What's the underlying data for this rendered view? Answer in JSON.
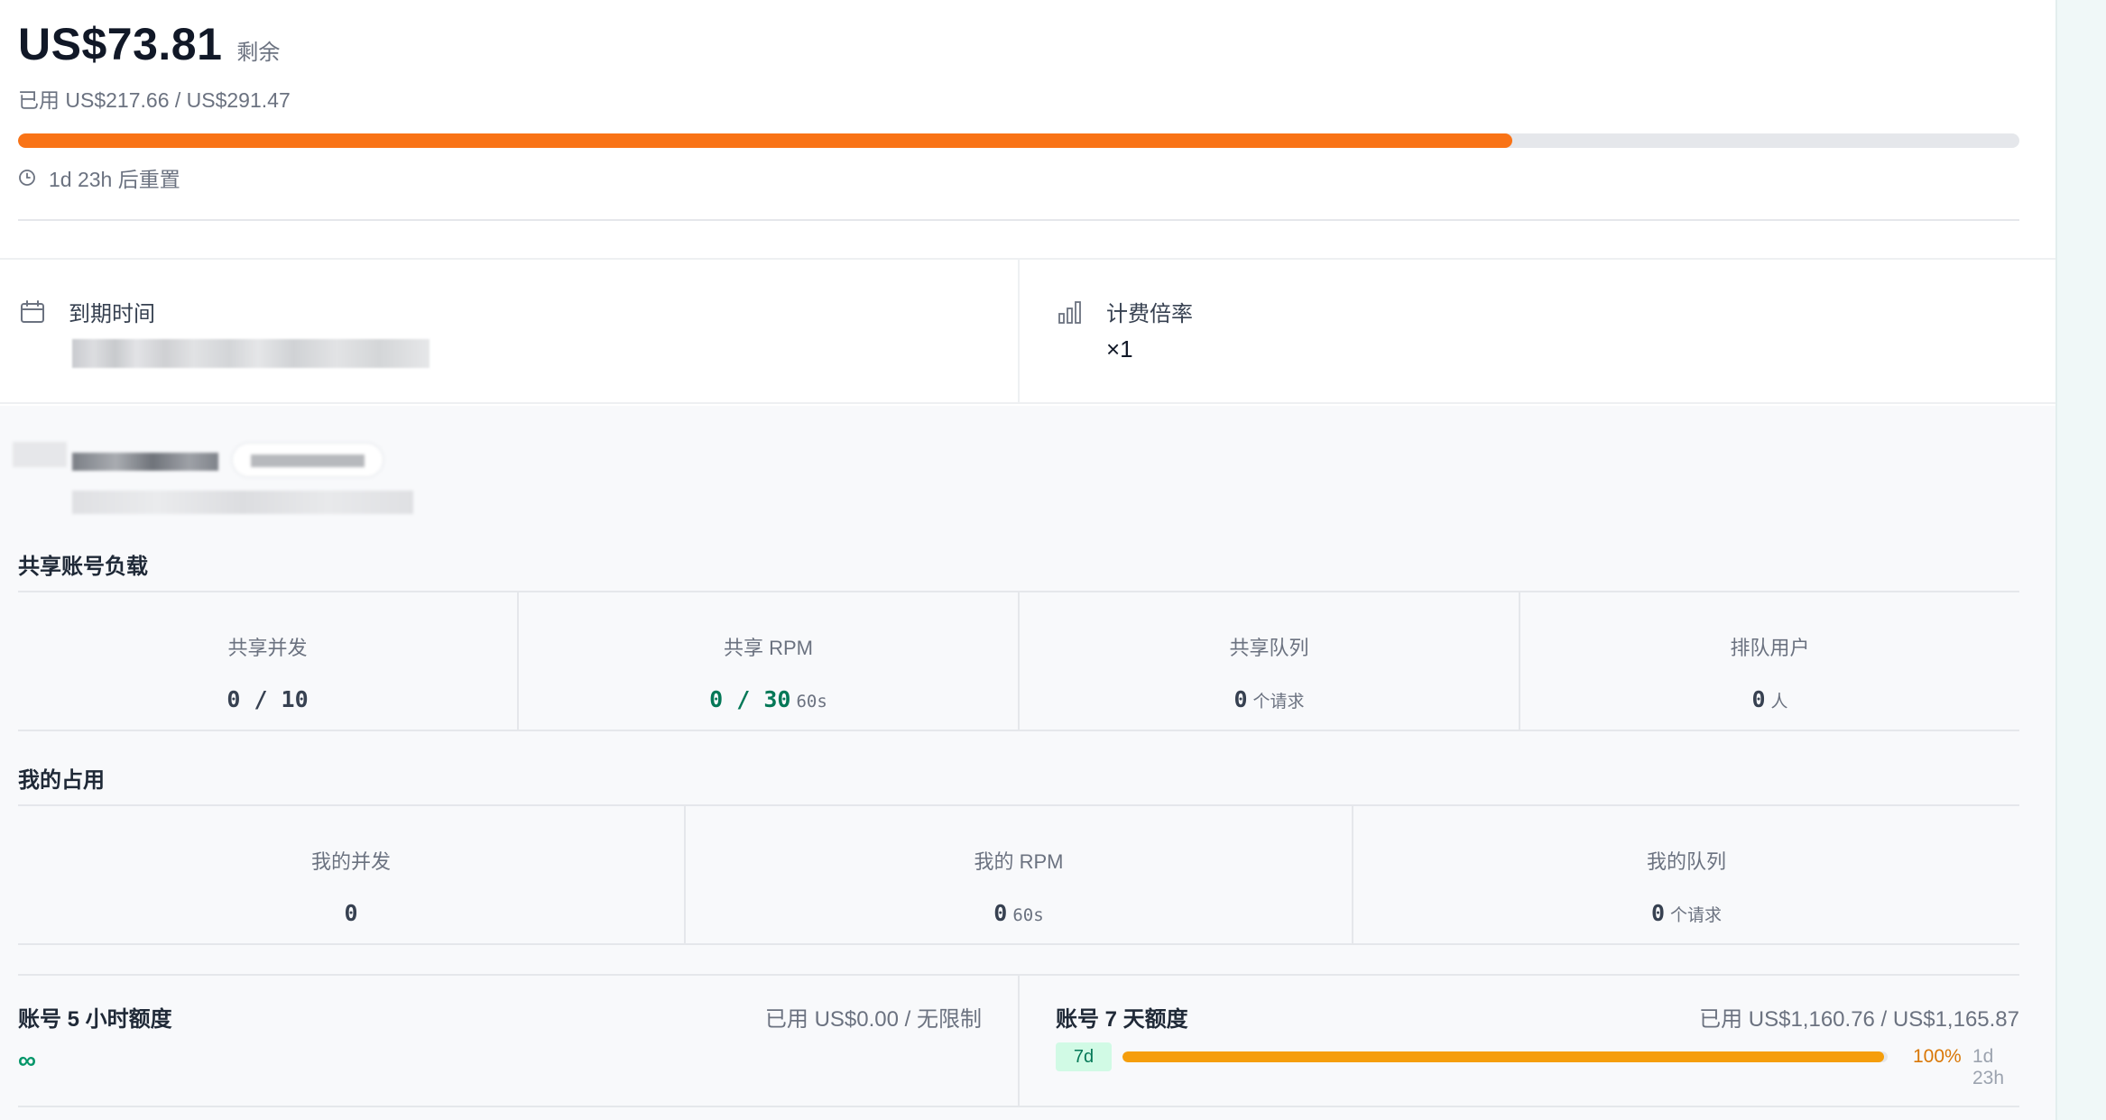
{
  "quota": {
    "remaining_amount": "US$73.81",
    "remaining_label": "剩余",
    "used_text": "已用 US$217.66 / US$291.47",
    "used_fraction": 0.7468,
    "reset_text": "1d 23h 后重置"
  },
  "info": {
    "expiry_title": "到期时间",
    "rate_title": "计费倍率",
    "rate_value": "×1"
  },
  "shared_load": {
    "title": "共享账号负载",
    "cells": [
      {
        "label": "共享并发",
        "value": "0 / 10",
        "unit": ""
      },
      {
        "label": "共享 RPM",
        "value": "0 / 30",
        "unit": "60s"
      },
      {
        "label": "共享队列",
        "value": "0",
        "unit": "个请求"
      },
      {
        "label": "排队用户",
        "value": "0",
        "unit": "人"
      }
    ]
  },
  "my_usage": {
    "title": "我的占用",
    "cells": [
      {
        "label": "我的并发",
        "value": "0",
        "unit": ""
      },
      {
        "label": "我的 RPM",
        "value": "0",
        "unit": "60s"
      },
      {
        "label": "我的队列",
        "value": "0",
        "unit": "个请求"
      }
    ]
  },
  "account_5h": {
    "title": "账号 5 小时额度",
    "used_text": "已用 US$0.00 / 无限制",
    "value": "∞"
  },
  "account_7d": {
    "title": "账号 7 天额度",
    "used_text": "已用 US$1,160.76 / US$1,165.87",
    "badge": "7d",
    "percent_text": "100%",
    "reset_text": "1d 23h",
    "used_fraction": 0.9956
  },
  "colors": {
    "accent_orange": "#f97316",
    "amber": "#f59e0b",
    "green": "#047857"
  }
}
